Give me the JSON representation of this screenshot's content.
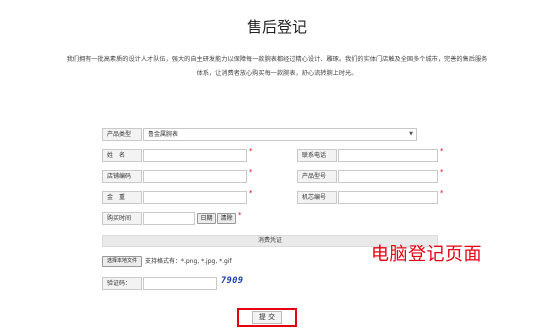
{
  "page": {
    "title": "售后登记",
    "intro_line1": "我们拥有一批高素质的设计人才队伍，强大的自主研发能力以保障每一款腕表都经过精心设计、雕琢。我们的实体门店触及全国多个城市，完善的售后服务",
    "intro_line2": "体系，让消费者放心购买每一款腕表，舒心流转腕上时光。"
  },
  "form": {
    "product_type": {
      "label": "产品类型",
      "value": "鲁金属腕表"
    },
    "name": {
      "label": "姓　名",
      "value": ""
    },
    "phone": {
      "label": "联系电话",
      "value": ""
    },
    "store_code": {
      "label": "店铺编码",
      "value": ""
    },
    "model": {
      "label": "产品型号",
      "value": ""
    },
    "weight": {
      "label": "金　重",
      "value": ""
    },
    "movement": {
      "label": "机芯编号",
      "value": ""
    },
    "purchase_time": {
      "label": "购买时间",
      "value": "",
      "date_button": "日期",
      "clear_button": "清除"
    },
    "required_mark": "*",
    "receipt": {
      "section_title": "消费凭证",
      "choose_button": "选择本地文件",
      "formats": "支持格式有：*.png, *.jpg, *.gif"
    },
    "captcha": {
      "label": "验证码：",
      "value": "",
      "code": "7909"
    },
    "submit_label": "提 交"
  },
  "overlay_text": "电脑登记页面",
  "colors": {
    "accent": "#e60012",
    "captcha": "#1a3fb3"
  }
}
